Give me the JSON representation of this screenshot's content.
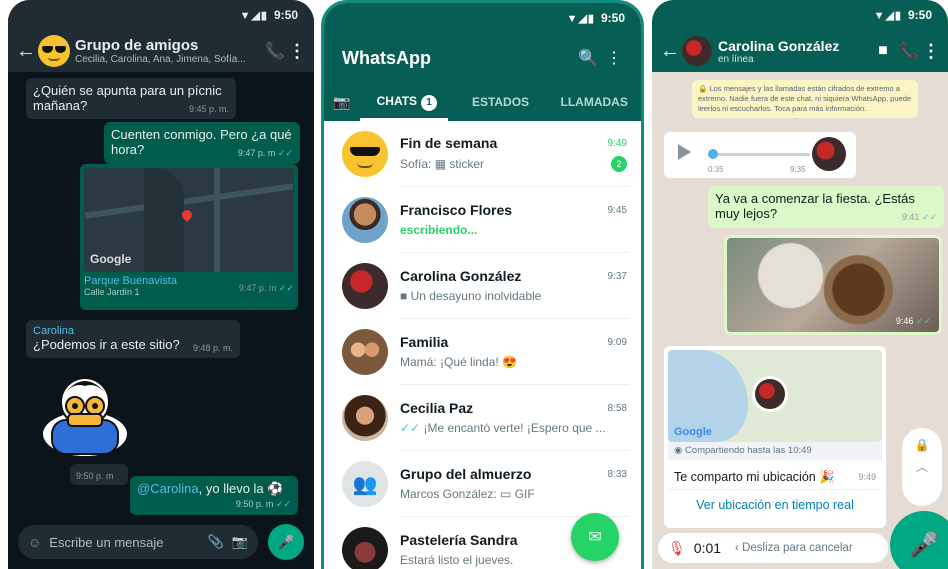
{
  "status_time": "9:50",
  "status_icons": "▼◢▮",
  "group_chat": {
    "title": "Grupo de amigos",
    "participants": "Cecilia, Carolina, Ana, Jimena, Sofía...",
    "messages": [
      {
        "text": "¿Quién se apunta para un pícnic mañana?",
        "time": "9:45 p. m."
      },
      {
        "text": "Cuenten conmigo. Pero ¿a qué hora?",
        "time": "9:47 p. m"
      },
      {
        "sender": "Carolina",
        "text": "¿Podemos ir a este sitio?",
        "time": "9:48 p. m."
      },
      {
        "time": "9:50 p. m"
      },
      {
        "mention": "@Carolina",
        "text": ", yo llevo la",
        "time": "9:50 p. m"
      }
    ],
    "location": {
      "brand": "Google",
      "name": "Parque Buenavista",
      "address": "Calle Jardín 1",
      "time": "9:47 p. m"
    },
    "compose_placeholder": "Escribe un mensaje"
  },
  "chat_list": {
    "app_name": "WhatsApp",
    "tabs": [
      {
        "label": "CHATS",
        "badge": "1"
      },
      {
        "label": "ESTADOS"
      },
      {
        "label": "LLAMADAS"
      }
    ],
    "chats": [
      {
        "name": "Fin de semana",
        "time": "9:49",
        "prefix": "Sofía: ",
        "message": "sticker",
        "unread": "2"
      },
      {
        "name": "Francisco Flores",
        "time": "9:45",
        "message": "escribiendo..."
      },
      {
        "name": "Carolina González",
        "time": "9:37",
        "message": "Un desayuno inolvidable"
      },
      {
        "name": "Familia",
        "time": "9:09",
        "prefix": "Mamá: ",
        "message": "¡Qué linda!"
      },
      {
        "name": "Cecilia Paz",
        "time": "8:58",
        "message": "¡Me encantó verte! ¡Espero que ..."
      },
      {
        "name": "Grupo del almuerzo",
        "time": "8:33",
        "prefix": "Marcos González: ",
        "message": "GIF"
      },
      {
        "name": "Pastelería Sandra",
        "time": "",
        "message": "Estará listo el jueves."
      }
    ],
    "colors": {
      "primary": "#075e54",
      "accent": "#25d366"
    }
  },
  "single_chat": {
    "title": "Carolina González",
    "subtitle": "en línea",
    "encryption_notice": "Los mensajes y las llamadas están cifrados de extremo a extremo. Nadie fuera de este chat, ni siquiera WhatsApp, puede leerlos ni escucharlos. Toca para más información.",
    "voice": {
      "position": "0:35",
      "time": "9:35"
    },
    "messages": [
      {
        "text": "Ya va a comenzar la fiesta. ¿Estás muy lejos?",
        "time": "9:41"
      },
      {
        "time": "9:46"
      }
    ],
    "live_location": {
      "brand": "Google",
      "sharing": "Compartiendo hasta las 10:49",
      "text": "Te comparto mi ubicación",
      "time": "9:49",
      "button": "Ver ubicación en tiempo real"
    },
    "recording": {
      "time": "0:01",
      "hint": "Desliza para cancelar"
    }
  }
}
